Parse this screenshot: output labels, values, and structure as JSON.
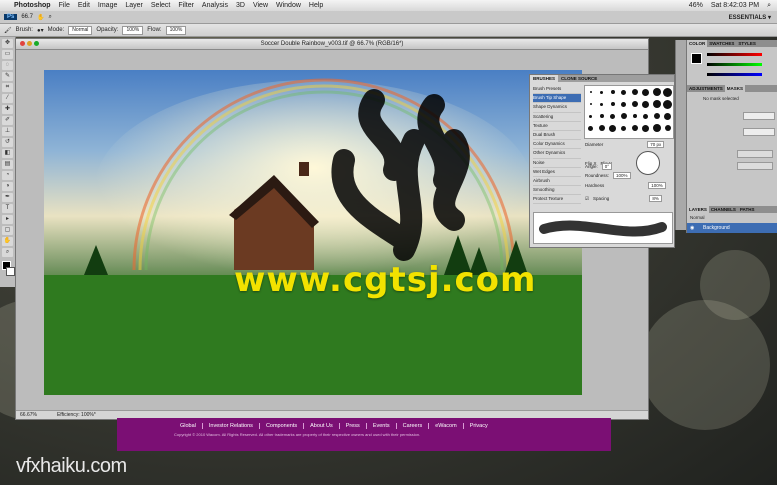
{
  "menubar": {
    "app_name": "Photoshop",
    "items": [
      "File",
      "Edit",
      "Image",
      "Layer",
      "Select",
      "Filter",
      "Analysis",
      "3D",
      "View",
      "Window",
      "Help"
    ],
    "status": [
      "46%",
      "Sat 8:42:03 PM"
    ]
  },
  "appbar": {
    "zoom": "66.7",
    "workspace": "ESSENTIALS ▾"
  },
  "options": {
    "brush_label": "Brush:",
    "mode_label": "Mode:",
    "mode_value": "Normal",
    "opacity_label": "Opacity:",
    "opacity_value": "100%",
    "flow_label": "Flow:",
    "flow_value": "100%"
  },
  "document": {
    "title": "Soccer Double Rainbow_v003.tif @ 66.7% (RGB/16*)",
    "zoom_status": "66.67%",
    "efficiency": "Efficiency: 100%*"
  },
  "watermark": "www.cgtsj.com",
  "brush_panel": {
    "tabs": [
      "BRUSHES",
      "CLONE SOURCE"
    ],
    "options": [
      "Brush Presets",
      "Brush Tip Shape",
      "Shape Dynamics",
      "Scattering",
      "Texture",
      "Dual Brush",
      "Color Dynamics",
      "Other Dynamics",
      "Noise",
      "Wet Edges",
      "Airbrush",
      "Smoothing",
      "Protect Texture"
    ],
    "selected_index": 1,
    "diameter_label": "Diameter",
    "diameter_value": "70 px",
    "flip_x": "Flip X",
    "flip_y": "Flip Y",
    "angle_label": "Angle:",
    "angle_value": "0°",
    "roundness_label": "Roundness:",
    "roundness_value": "100%",
    "hardness_label": "Hardness",
    "hardness_value": "100%",
    "spacing_label": "Spacing",
    "spacing_value": "8%"
  },
  "right_panels": {
    "color_tabs": [
      "COLOR",
      "SWATCHES",
      "STYLES"
    ],
    "adj_tabs": [
      "ADJUSTMENTS",
      "MASKS"
    ],
    "mask_text": "No mask selected",
    "layer_tabs": [
      "LAYERS",
      "CHANNELS",
      "PATHS"
    ],
    "blend_mode": "Normal",
    "layer_name": "Background"
  },
  "website": {
    "nav": [
      "Global",
      "Investor Relations",
      "Components",
      "About Us",
      "Press",
      "Events",
      "Careers",
      "eWacom",
      "Privacy"
    ],
    "copyright": "Copyright © 2010 Wacom. All Rights Reserved. All other trademarks are property of their respective owners and used with their permission."
  },
  "brand_overlay": "vfxhaiku.com"
}
